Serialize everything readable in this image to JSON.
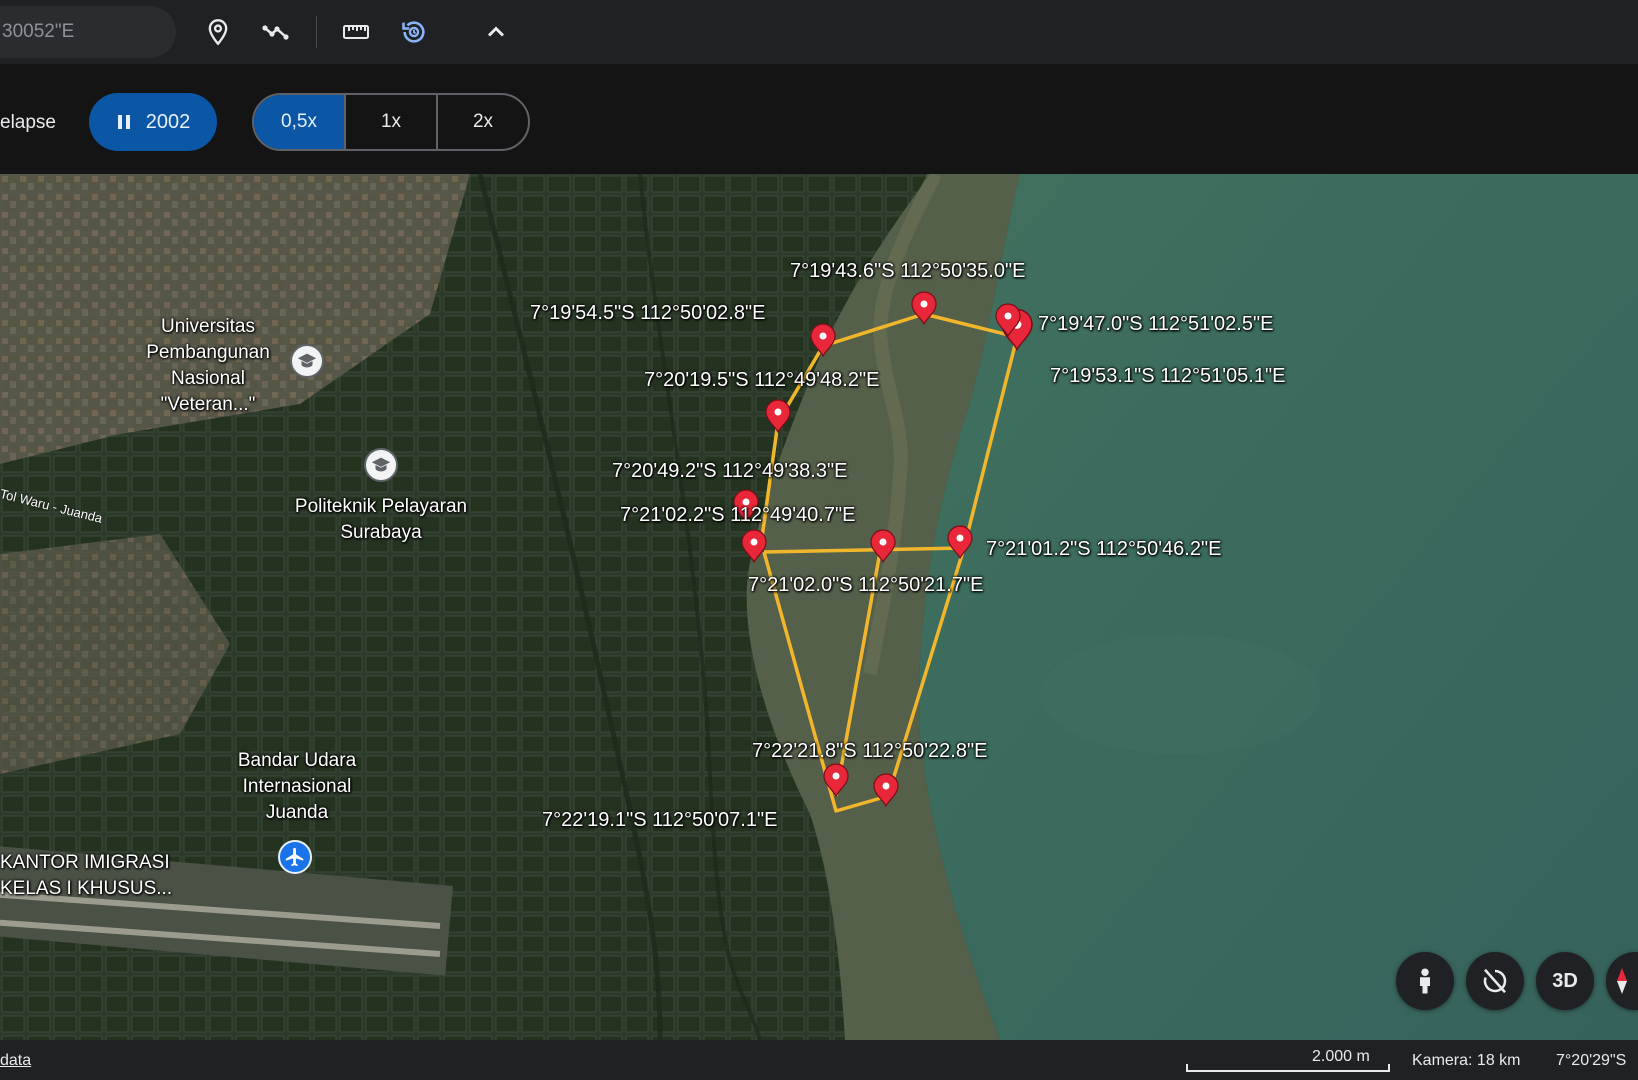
{
  "toolbar": {
    "search_value": "30052\"E",
    "icons": [
      "placemark-icon",
      "path-icon",
      "ruler-icon",
      "historical-imagery-icon",
      "chevron-up-icon"
    ]
  },
  "timelapse": {
    "label": "elapse",
    "play_state": "pause",
    "year": "2002",
    "speeds": [
      "0,5x",
      "1x",
      "2x"
    ],
    "selected_speed": "0,5x"
  },
  "map": {
    "coordinate_labels": [
      "7°19'43.6\"S 112°50'35.0\"E",
      "7°19'54.5\"S 112°50'02.8\"E",
      "7°19'47.0\"S 112°51'02.5\"E",
      "7°19'53.1\"S 112°51'05.1\"E",
      "7°20'19.5\"S 112°49'48.2\"E",
      "7°20'49.2\"S 112°49'38.3\"E",
      "7°21'02.2\"S 112°49'40.7\"E",
      "7°21'01.2\"S 112°50'46.2\"E",
      "7°21'02.0\"S 112°50'21.7\"E",
      "7°22'21.8\"S 112°50'22.8\"E",
      "7°22'19.1\"S 112°50'07.1\"E"
    ],
    "places": {
      "university": "Universitas Pembangunan Nasional \"Veteran...\"",
      "polytechnic": "Politeknik Pelayaran Surabaya",
      "airport": "Bandar Udara Internasional Juanda",
      "immigration": "KANTOR IMIGRASI KELAS I KHUSUS...",
      "road": "Tol Waru - Juanda"
    },
    "controls": {
      "pegman": "pegman-icon",
      "rotate": "rotate-off-icon",
      "view_3d": "3D",
      "compass": "compass-icon"
    },
    "colors": {
      "polygon": "#f2b62c",
      "marker": "#e8283a",
      "sea": "#3c6a5f"
    }
  },
  "status": {
    "data_link": "data",
    "scale": "2.000 m",
    "camera": "Kamera: 18 km",
    "coordinates": "7°20'29\"S"
  }
}
